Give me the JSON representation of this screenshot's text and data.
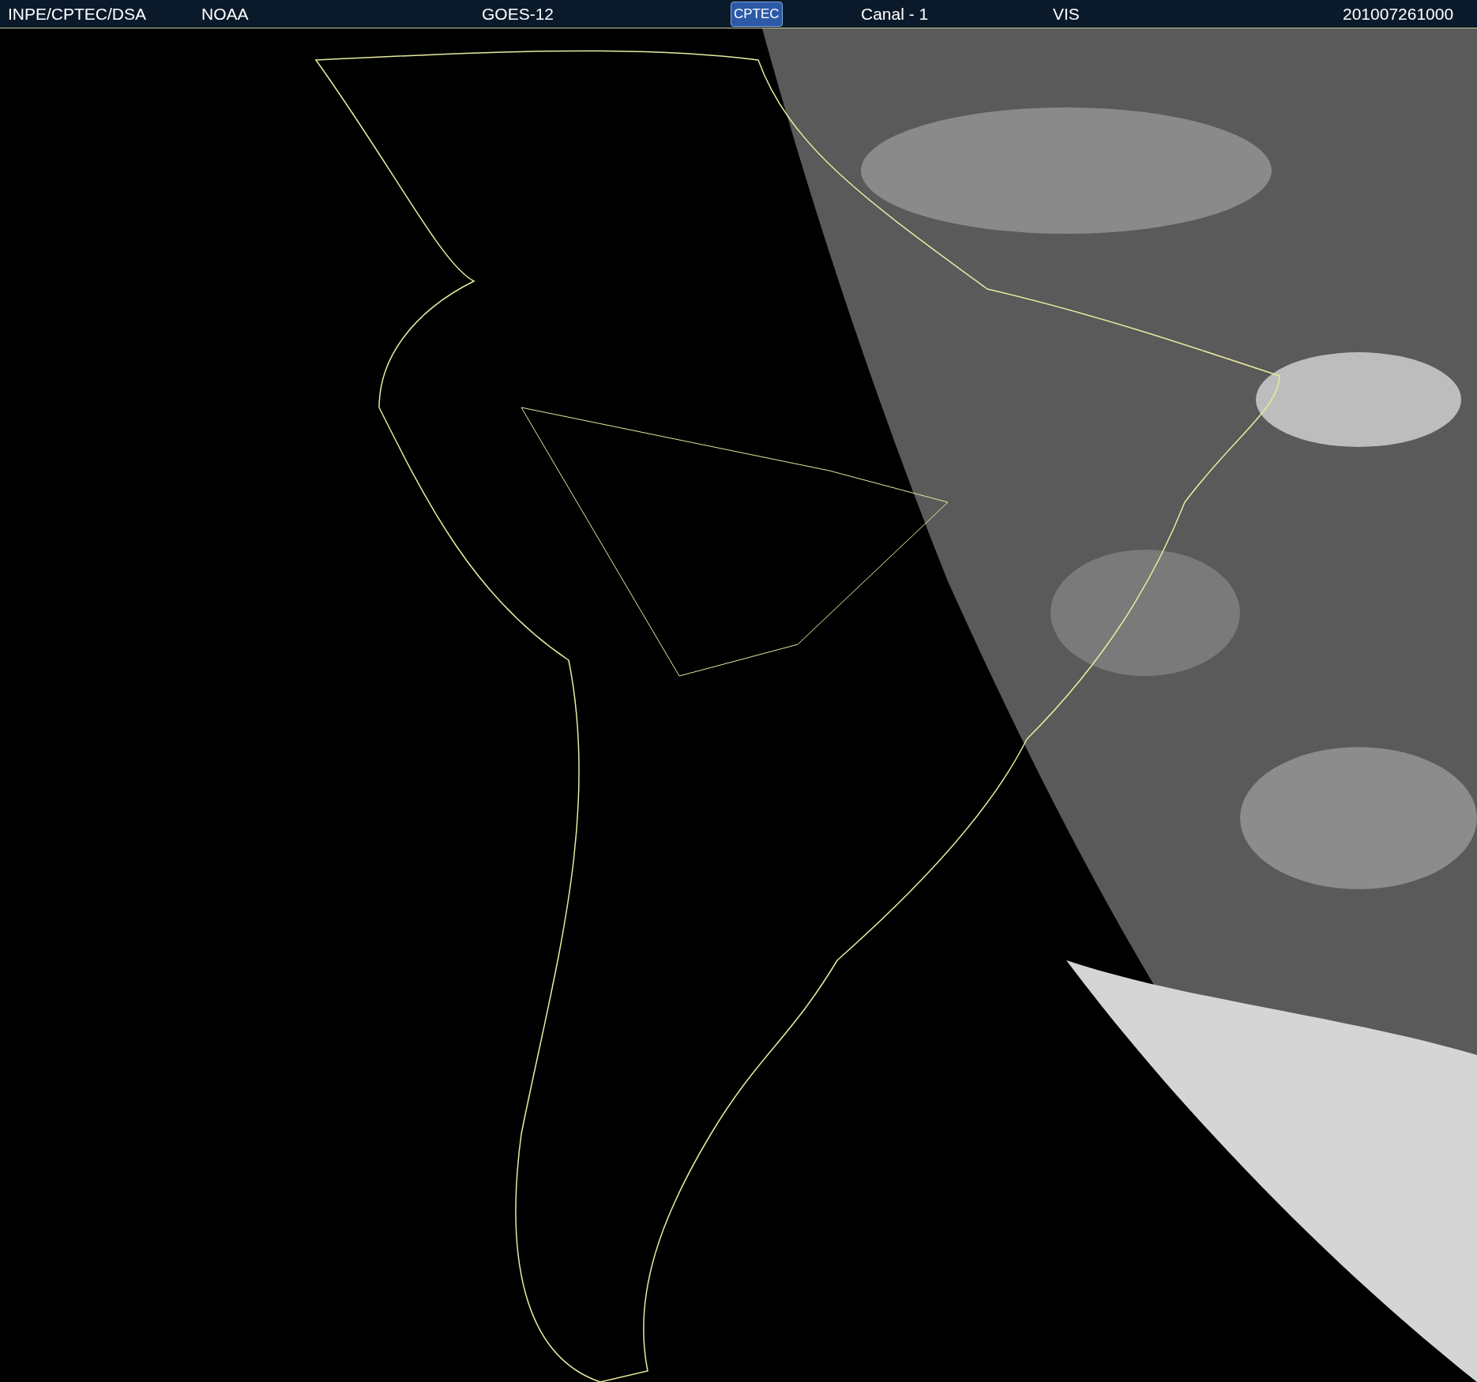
{
  "header": {
    "items": [
      {
        "kind": "text",
        "text": "INPE/CPTEC/DSA"
      },
      {
        "kind": "text",
        "text": "NOAA"
      },
      {
        "kind": "text",
        "text": "GOES-12"
      },
      {
        "kind": "logo",
        "text": "CPTEC"
      },
      {
        "kind": "text",
        "text": "Canal - 1"
      },
      {
        "kind": "text",
        "text": "VIS"
      },
      {
        "kind": "text",
        "text": "201007261000"
      }
    ]
  }
}
